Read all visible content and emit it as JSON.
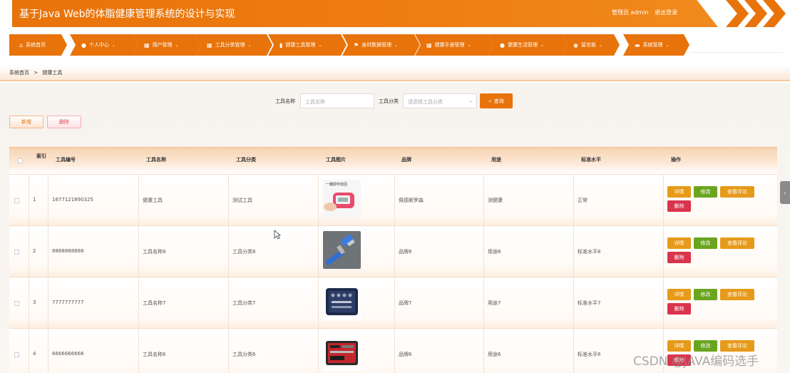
{
  "header": {
    "title": "基于Java Web的体脂健康管理系统的设计与实现",
    "user_label": "管理员 admin",
    "logout_label": "退出登录"
  },
  "nav": {
    "items": [
      {
        "label": "系统首页",
        "icon": "home-icon",
        "has_dropdown": false
      },
      {
        "label": "个人中心",
        "icon": "user-icon",
        "has_dropdown": true
      },
      {
        "label": "用户管理",
        "icon": "grid-icon",
        "has_dropdown": true
      },
      {
        "label": "工具分类管理",
        "icon": "grid-icon",
        "has_dropdown": true
      },
      {
        "label": "健康工具管理",
        "icon": "bar-chart-icon",
        "has_dropdown": true
      },
      {
        "label": "身材数据管理",
        "icon": "flag-icon",
        "has_dropdown": true
      },
      {
        "label": "健康手册管理",
        "icon": "grid-icon",
        "has_dropdown": true
      },
      {
        "label": "健康生活管理",
        "icon": "user-icon",
        "has_dropdown": true
      },
      {
        "label": "留言板",
        "icon": "pin-icon",
        "has_dropdown": true
      },
      {
        "label": "系统管理",
        "icon": "print-icon",
        "has_dropdown": true
      }
    ]
  },
  "breadcrumb": {
    "home": "系统首页",
    "separator": ">",
    "current": "健康工具"
  },
  "search": {
    "name_label": "工具名称",
    "name_placeholder": "工具名称",
    "category_label": "工具分类",
    "category_placeholder": "请选择工具分类",
    "query_label": "查询"
  },
  "toolbar": {
    "add_label": "新增",
    "delete_label": "删除"
  },
  "table": {
    "headers": {
      "index": "索引",
      "code": "工具编号",
      "name": "工具名称",
      "category": "工具分类",
      "image": "工具图片",
      "brand": "品牌",
      "usage": "用途",
      "level": "标准水平",
      "actions": "操作"
    },
    "action_labels": {
      "detail": "详情",
      "edit": "修改",
      "review": "查看评论",
      "delete": "删除"
    },
    "rows": [
      {
        "index": "1",
        "code": "1677121890325",
        "name": "健康工具",
        "category": "测试工具",
        "image_caption": "一键即可收回",
        "brand": "佩德斯罗森",
        "usage": "测健康",
        "level": "正常"
      },
      {
        "index": "2",
        "code": "8888888888",
        "name": "工具名称8",
        "category": "工具分类8",
        "image_caption": "",
        "brand": "品牌8",
        "usage": "用途8",
        "level": "标准水平8"
      },
      {
        "index": "3",
        "code": "7777777777",
        "name": "工具名称7",
        "category": "工具分类7",
        "image_caption": "",
        "brand": "品牌7",
        "usage": "用途7",
        "level": "标准水平7"
      },
      {
        "index": "4",
        "code": "6666666666",
        "name": "工具名称6",
        "category": "工具分类6",
        "image_caption": "",
        "brand": "品牌6",
        "usage": "用途6",
        "level": "标准水平6"
      }
    ]
  },
  "watermark": "CSDN @JAVA编码选手",
  "colors": {
    "accent": "#e8730a",
    "detail": "#e69a1a",
    "edit": "#6aa51f",
    "delete": "#d9344c"
  }
}
